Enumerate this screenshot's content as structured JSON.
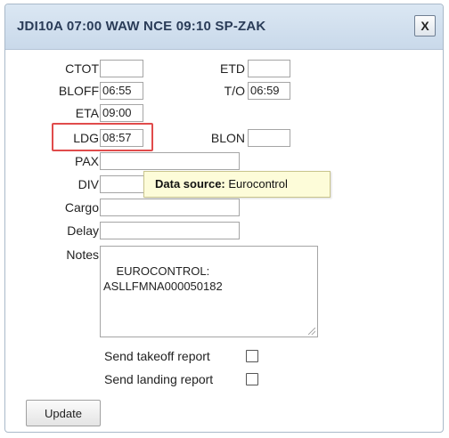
{
  "dialog": {
    "title": "JDI10A 07:00 WAW NCE 09:10 SP-ZAK",
    "close_label": "X"
  },
  "fields": {
    "ctot": {
      "label": "CTOT",
      "value": ""
    },
    "etd": {
      "label": "ETD",
      "value": ""
    },
    "bloff": {
      "label": "BLOFF",
      "value": "06:55"
    },
    "to": {
      "label": "T/O",
      "value": "06:59"
    },
    "eta": {
      "label": "ETA",
      "value": "09:00"
    },
    "ldg": {
      "label": "LDG",
      "value": "08:57"
    },
    "blon": {
      "label": "BLON",
      "value": ""
    },
    "pax": {
      "label": "PAX",
      "value": ""
    },
    "div": {
      "label": "DIV",
      "value": ""
    },
    "cargo": {
      "label": "Cargo",
      "value": ""
    },
    "delay": {
      "label": "Delay",
      "value": ""
    },
    "notes": {
      "label": "Notes",
      "value": "EUROCONTROL:\nASLLFMNA000050182"
    }
  },
  "tooltip": {
    "key": "Data source:",
    "value": "Eurocontrol"
  },
  "checkboxes": {
    "takeoff": {
      "label": "Send takeoff report",
      "checked": false
    },
    "landing": {
      "label": "Send landing report",
      "checked": false
    }
  },
  "update_label": "Update",
  "colors": {
    "titlebar": "#d2e0ee",
    "title_text": "#2a3c58",
    "highlight": "#e04b4b",
    "tooltip_bg": "#fdfcd9"
  }
}
